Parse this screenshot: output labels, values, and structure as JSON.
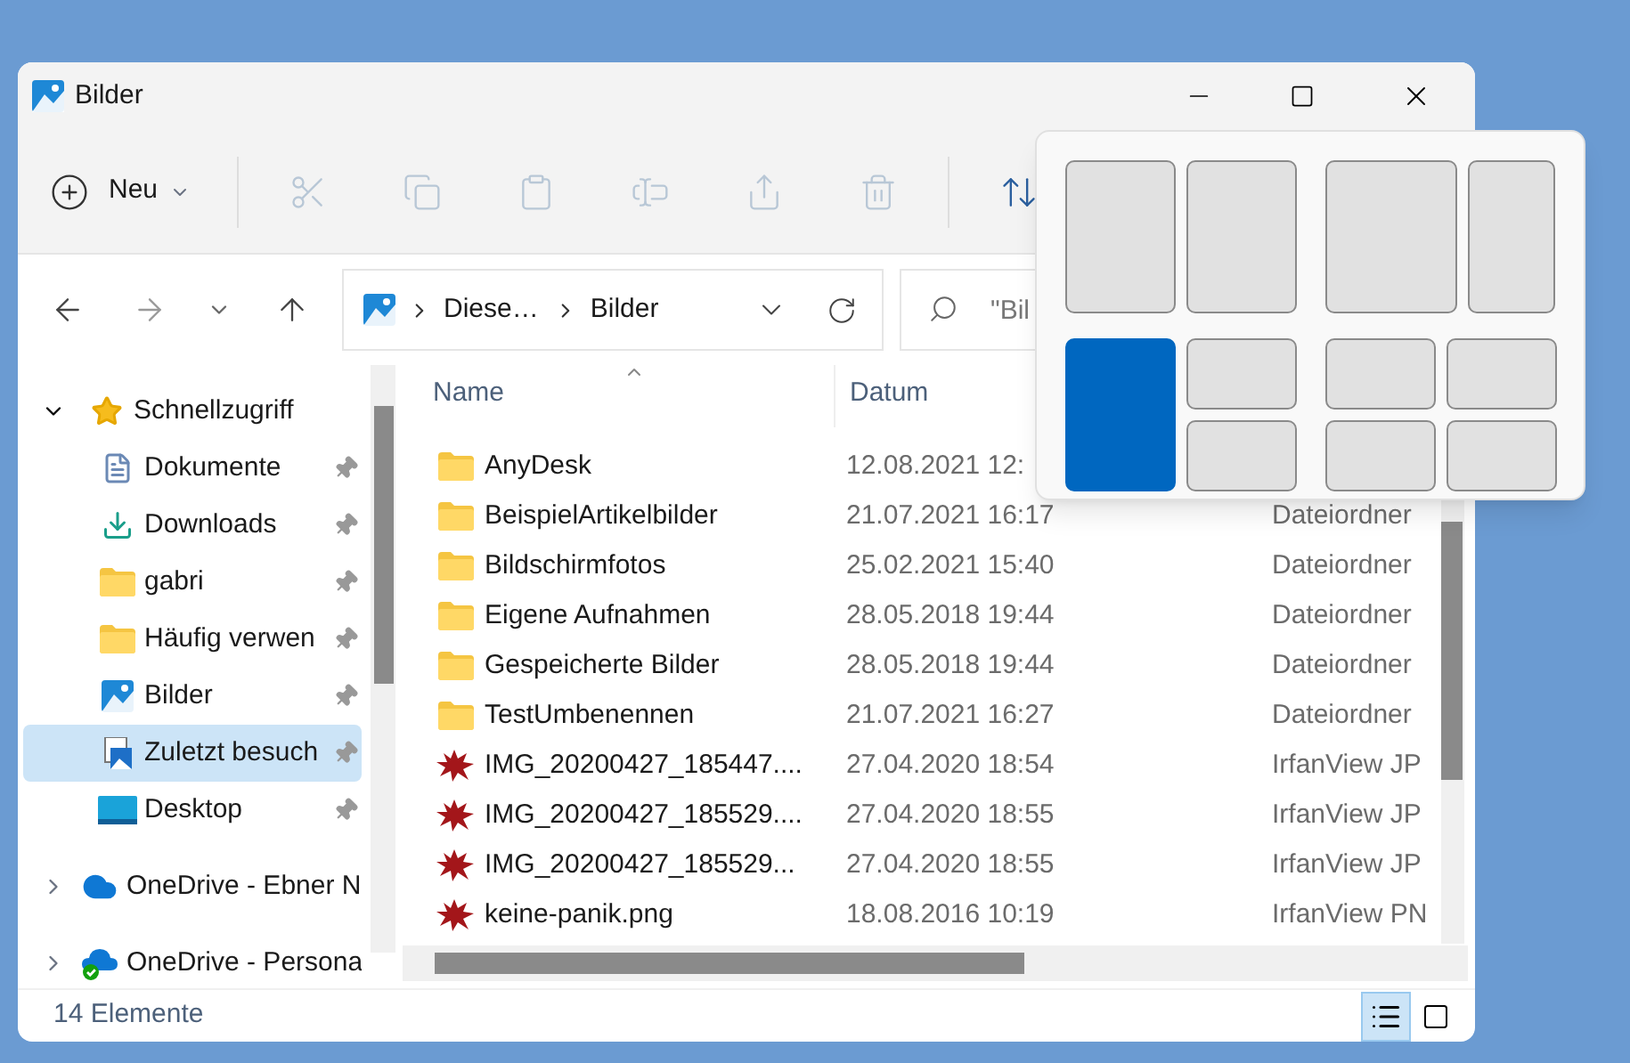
{
  "window": {
    "title": "Bilder"
  },
  "toolbar": {
    "new_label": "Neu",
    "actions": [
      {
        "kind": "cut",
        "disabled": true
      },
      {
        "kind": "copy",
        "disabled": true
      },
      {
        "kind": "paste",
        "disabled": true
      },
      {
        "kind": "rename",
        "disabled": true
      },
      {
        "kind": "share",
        "disabled": true
      },
      {
        "kind": "delete",
        "disabled": true
      },
      {
        "kind": "sort",
        "disabled": false
      }
    ]
  },
  "address_bar": {
    "segments": [
      "Diese…",
      "Bilder"
    ]
  },
  "search": {
    "placeholder": "\"Bil"
  },
  "sidebar": {
    "items": [
      {
        "label": "Schnellzugriff",
        "kind": "star",
        "expanded": true,
        "selected": false,
        "children": [
          {
            "label": "Dokumente",
            "kind": "document",
            "pinned": true,
            "selected": false
          },
          {
            "label": "Downloads",
            "kind": "download",
            "pinned": true,
            "selected": false
          },
          {
            "label": "gabri",
            "kind": "folder",
            "pinned": true,
            "selected": false
          },
          {
            "label": "Häufig verwen",
            "kind": "recent-folder",
            "pinned": true,
            "selected": false
          },
          {
            "label": "Bilder",
            "kind": "pictures",
            "pinned": true,
            "selected": false
          },
          {
            "label": "Zuletzt besuch",
            "kind": "recent",
            "pinned": true,
            "selected": true
          },
          {
            "label": "Desktop",
            "kind": "desktop",
            "pinned": true,
            "selected": false
          }
        ]
      },
      {
        "label": "OneDrive - Ebner N",
        "kind": "cloud",
        "expanded": false,
        "selected": false
      },
      {
        "label": "OneDrive - Persona",
        "kind": "cloud-synced",
        "expanded": false,
        "selected": false
      }
    ]
  },
  "table": {
    "columns": [
      "Name",
      "Datum"
    ],
    "rows": [
      {
        "name": "AnyDesk",
        "kind": "folder",
        "date": "12.08.2021 12:"
      },
      {
        "name": "BeispielArtikelbilder",
        "kind": "folder",
        "date": "21.07.2021 16:17",
        "type": "Dateiordner"
      },
      {
        "name": "Bildschirmfotos",
        "kind": "folder",
        "date": "25.02.2021 15:40",
        "type": "Dateiordner"
      },
      {
        "name": "Eigene Aufnahmen",
        "kind": "folder",
        "date": "28.05.2018 19:44",
        "type": "Dateiordner"
      },
      {
        "name": "Gespeicherte Bilder",
        "kind": "folder",
        "date": "28.05.2018 19:44",
        "type": "Dateiordner"
      },
      {
        "name": "TestUmbenennen",
        "kind": "folder",
        "date": "21.07.2021 16:27",
        "type": "Dateiordner"
      },
      {
        "name": "IMG_20200427_185447....",
        "kind": "image",
        "date": "27.04.2020 18:54",
        "type": "IrfanView JP"
      },
      {
        "name": "IMG_20200427_185529....",
        "kind": "image",
        "date": "27.04.2020 18:55",
        "type": "IrfanView JP"
      },
      {
        "name": "IMG_20200427_185529...",
        "kind": "image",
        "date": "27.04.2020 18:55",
        "type": "IrfanView JP"
      },
      {
        "name": "keine-panik.png",
        "kind": "image",
        "date": "18.08.2016 10:19",
        "type": "IrfanView PN"
      }
    ]
  },
  "status_bar": {
    "count": "14 Elemente",
    "views": [
      {
        "kind": "details",
        "selected": true
      },
      {
        "kind": "tiles",
        "selected": false
      }
    ]
  },
  "snap_layouts": [
    {
      "kind": "halves",
      "zones": [
        {
          "selected": false
        },
        {
          "selected": false
        }
      ]
    },
    {
      "kind": "two-thirds",
      "zones": [
        {
          "selected": false
        },
        {
          "selected": false
        }
      ]
    },
    {
      "kind": "left-and-quarters",
      "zones": [
        {
          "selected": true
        },
        {
          "selected": false
        },
        {
          "selected": false
        }
      ]
    },
    {
      "kind": "quarters",
      "zones": [
        {
          "selected": false
        },
        {
          "selected": false
        },
        {
          "selected": false
        },
        {
          "selected": false
        }
      ]
    }
  ]
}
